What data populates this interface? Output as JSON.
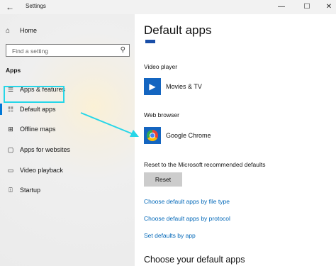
{
  "window": {
    "title": "Settings",
    "back_icon": "←",
    "minimize_icon": "—",
    "maximize_icon": "☐",
    "close_icon": "✕"
  },
  "sidebar": {
    "home": "Home",
    "search_placeholder": "Find a setting",
    "section": "Apps",
    "items": [
      {
        "label": "Apps & features",
        "icon": "list-icon"
      },
      {
        "label": "Default apps",
        "icon": "default-apps-icon",
        "selected": true
      },
      {
        "label": "Offline maps",
        "icon": "map-icon"
      },
      {
        "label": "Apps for websites",
        "icon": "web-icon"
      },
      {
        "label": "Video playback",
        "icon": "video-icon"
      },
      {
        "label": "Startup",
        "icon": "startup-icon"
      }
    ]
  },
  "main": {
    "title": "Default apps",
    "video_player_label": "Video player",
    "video_player_app": "Movies & TV",
    "web_browser_label": "Web browser",
    "web_browser_app": "Google Chrome",
    "reset_text": "Reset to the Microsoft recommended defaults",
    "reset_button": "Reset",
    "links": [
      "Choose default apps by file type",
      "Choose default apps by protocol",
      "Set defaults by app"
    ],
    "sub_title": "Choose your default apps"
  },
  "colors": {
    "accent": "#0078d7",
    "link": "#0067b8",
    "annotation": "#26d6e8"
  }
}
